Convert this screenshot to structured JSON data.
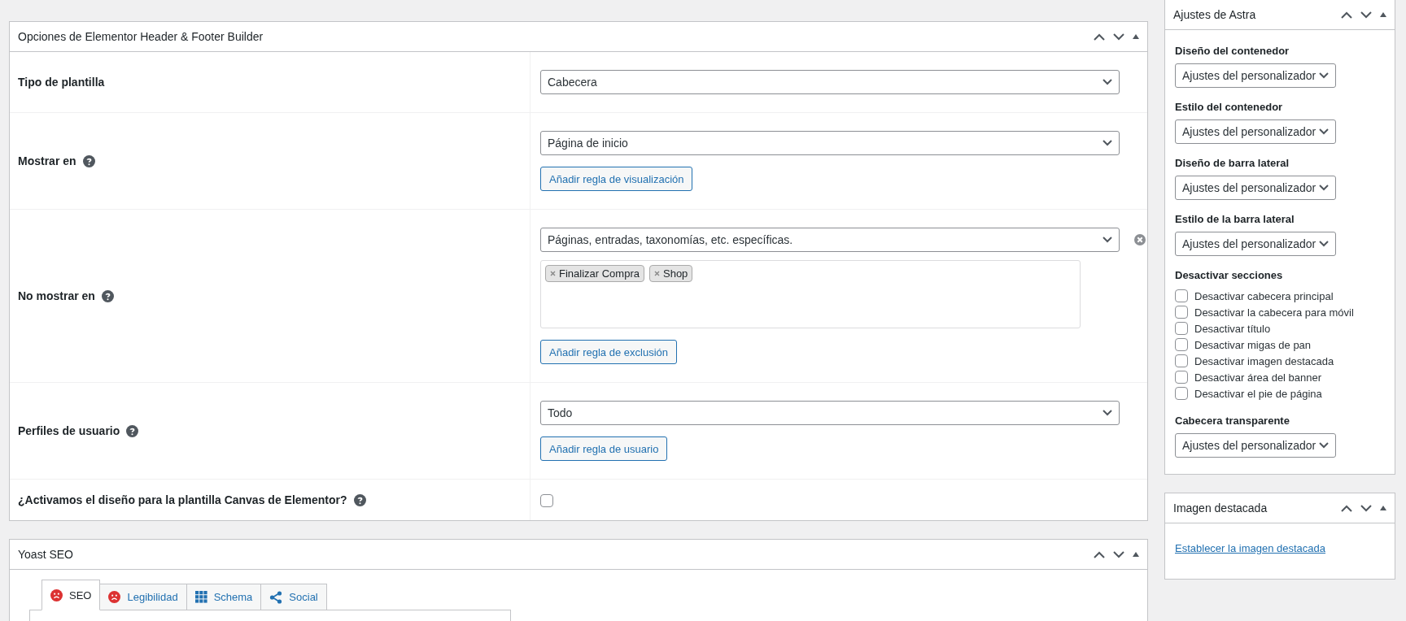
{
  "elementor_panel": {
    "title": "Opciones de Elementor Header & Footer Builder",
    "rows": [
      {
        "kind": "select",
        "label": "Tipo de plantilla",
        "help": false,
        "value": "Cabecera"
      },
      {
        "kind": "select_rule",
        "label": "Mostrar en",
        "help": true,
        "value": "Página de inicio",
        "button": "Añadir regla de visualización"
      },
      {
        "kind": "exclusion",
        "label": "No mostrar en",
        "help": true,
        "value": "Páginas, entradas, taxonomías, etc. específicas.",
        "tags": [
          "Finalizar Compra",
          "Shop"
        ],
        "button": "Añadir regla de exclusión"
      },
      {
        "kind": "select_rule",
        "label": "Perfiles de usuario",
        "help": true,
        "value": "Todo",
        "button": "Añadir regla de usuario"
      },
      {
        "kind": "checkbox",
        "label": "¿Activamos el diseño para la plantilla Canvas de Elementor?",
        "help": true,
        "checked": false
      }
    ]
  },
  "yoast_panel": {
    "title": "Yoast SEO",
    "tabs": [
      {
        "label": "SEO",
        "kind": "score",
        "selected": true
      },
      {
        "label": "Legibilidad",
        "kind": "score",
        "selected": false
      },
      {
        "label": "Schema",
        "kind": "schema",
        "selected": false
      },
      {
        "label": "Social",
        "kind": "social",
        "selected": false
      }
    ]
  },
  "astra_panel": {
    "title": "Ajustes de Astra",
    "fields": [
      {
        "kind": "select",
        "label": "Diseño del contenedor",
        "value": "Ajustes del personalizador"
      },
      {
        "kind": "select",
        "label": "Estilo del contenedor",
        "value": "Ajustes del personalizador"
      },
      {
        "kind": "select",
        "label": "Diseño de barra lateral",
        "value": "Ajustes del personalizador"
      },
      {
        "kind": "select",
        "label": "Estilo de la barra lateral",
        "value": "Ajustes del personalizador"
      },
      {
        "kind": "checklist",
        "label": "Desactivar secciones",
        "items": [
          {
            "label": "Desactivar cabecera principal",
            "checked": false
          },
          {
            "label": "Desactivar la cabecera para móvil",
            "checked": false
          },
          {
            "label": "Desactivar título",
            "checked": false
          },
          {
            "label": "Desactivar migas de pan",
            "checked": false
          },
          {
            "label": "Desactivar imagen destacada",
            "checked": false
          },
          {
            "label": "Desactivar área del banner",
            "checked": false
          },
          {
            "label": "Desactivar el pie de página",
            "checked": false
          }
        ]
      },
      {
        "kind": "select",
        "label": "Cabecera transparente",
        "value": "Ajustes del personalizador"
      }
    ]
  },
  "featured_image_panel": {
    "title": "Imagen destacada",
    "link": "Establecer la imagen destacada"
  }
}
